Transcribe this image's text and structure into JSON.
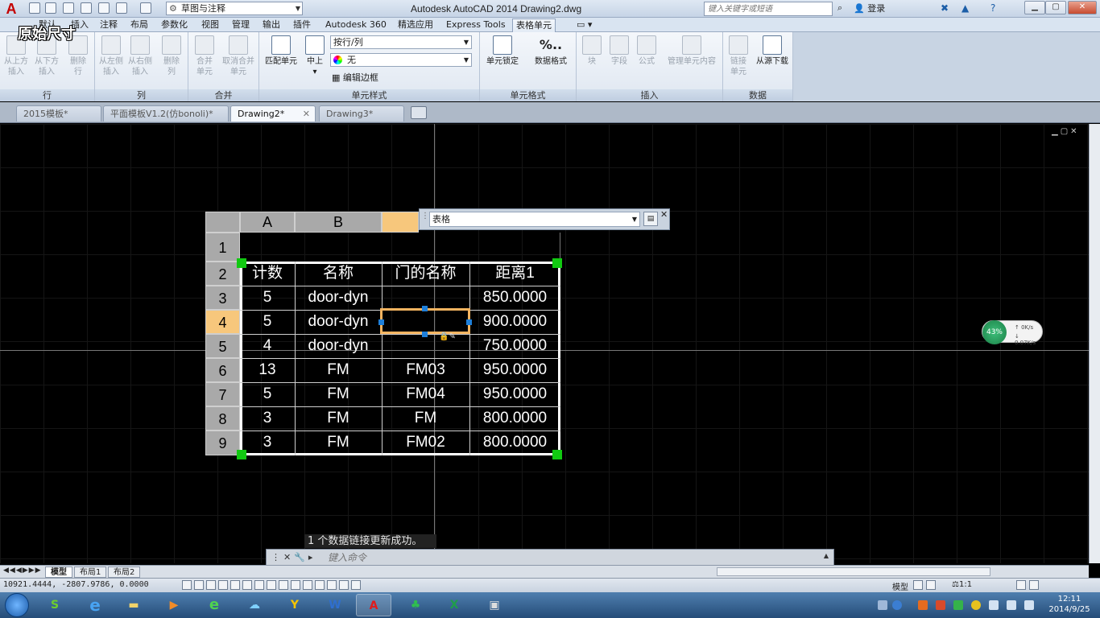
{
  "title_bar": {
    "app_logo": "A",
    "workspace": "草图与注释",
    "window_title": "Autodesk AutoCAD 2014    Drawing2.dwg",
    "search_placeholder": "键入关键字或短语",
    "login": "登录"
  },
  "overlay_label": "原始尺寸",
  "ribbon_tabs": [
    "默认",
    "插入",
    "注释",
    "布局",
    "参数化",
    "视图",
    "管理",
    "输出",
    "插件",
    "Autodesk 360",
    "精选应用",
    "Express Tools",
    "表格单元"
  ],
  "ribbon": {
    "panels": {
      "row": "行",
      "column": "列",
      "merge": "合并",
      "cell_style": "单元样式",
      "cell_format": "单元格式",
      "insert": "插入",
      "data": "数据"
    },
    "buttons": {
      "insert_above": "从上方\n插入",
      "insert_below": "从下方\n插入",
      "delete_row": "删除\n行",
      "insert_left": "从左侧\n插入",
      "insert_right": "从右侧\n插入",
      "delete_col": "删除\n列",
      "merge_cells": "合并\n单元",
      "unmerge_cells": "取消合并\n单元",
      "match_cell": "匹配单元",
      "align": "中上",
      "cell_lock": "单元锁定",
      "data_format": "数据格式",
      "block": "块",
      "field": "字段",
      "formula": "公式",
      "manage_content": "管理单元内容",
      "link_cell": "链接\n单元",
      "download_source": "从源下载"
    },
    "style_combo": "按行/列",
    "fill_combo": "无",
    "edit_borders": "编辑边框",
    "data_format_icon": "%.."
  },
  "file_tabs": [
    {
      "label": "2015模板*"
    },
    {
      "label": "平面模板V1.2(仿bonoli)*"
    },
    {
      "label": "Drawing2*"
    },
    {
      "label": "Drawing3*"
    }
  ],
  "table": {
    "col_headers": [
      "A",
      "B",
      "",
      ""
    ],
    "row_headers": [
      "1",
      "2",
      "3",
      "4",
      "5",
      "6",
      "7",
      "8",
      "9"
    ],
    "header": [
      "计数",
      "名称",
      "门的名称",
      "距离1"
    ],
    "rows": [
      [
        "5",
        "door-dyn",
        "",
        "850.0000"
      ],
      [
        "5",
        "door-dyn",
        "",
        "900.0000"
      ],
      [
        "4",
        "door-dyn",
        "",
        "750.0000"
      ],
      [
        "13",
        "FM",
        "FM03",
        "950.0000"
      ],
      [
        "5",
        "FM",
        "FM04",
        "950.0000"
      ],
      [
        "3",
        "FM",
        "FM",
        "800.0000"
      ],
      [
        "3",
        "FM",
        "FM02",
        "800.0000"
      ]
    ]
  },
  "table_style_bar": {
    "value": "表格"
  },
  "command": {
    "history": "1 个数据链接更新成功。",
    "placeholder": "键入命令"
  },
  "layout_tabs": [
    "模型",
    "布局1",
    "布局2"
  ],
  "status": {
    "coords": "10921.4444, -2807.9786, 0.0000",
    "model": "模型",
    "scale": "1:1"
  },
  "netwidget": {
    "percent": "43%",
    "up": "0K/s",
    "down": "0.07K/s"
  },
  "taskbar": {
    "time": "12:11",
    "date": "2014/9/25"
  },
  "colors": {
    "selected_cell_border": "#f4b460",
    "grip": "#11c911",
    "canvas": "#000000"
  }
}
